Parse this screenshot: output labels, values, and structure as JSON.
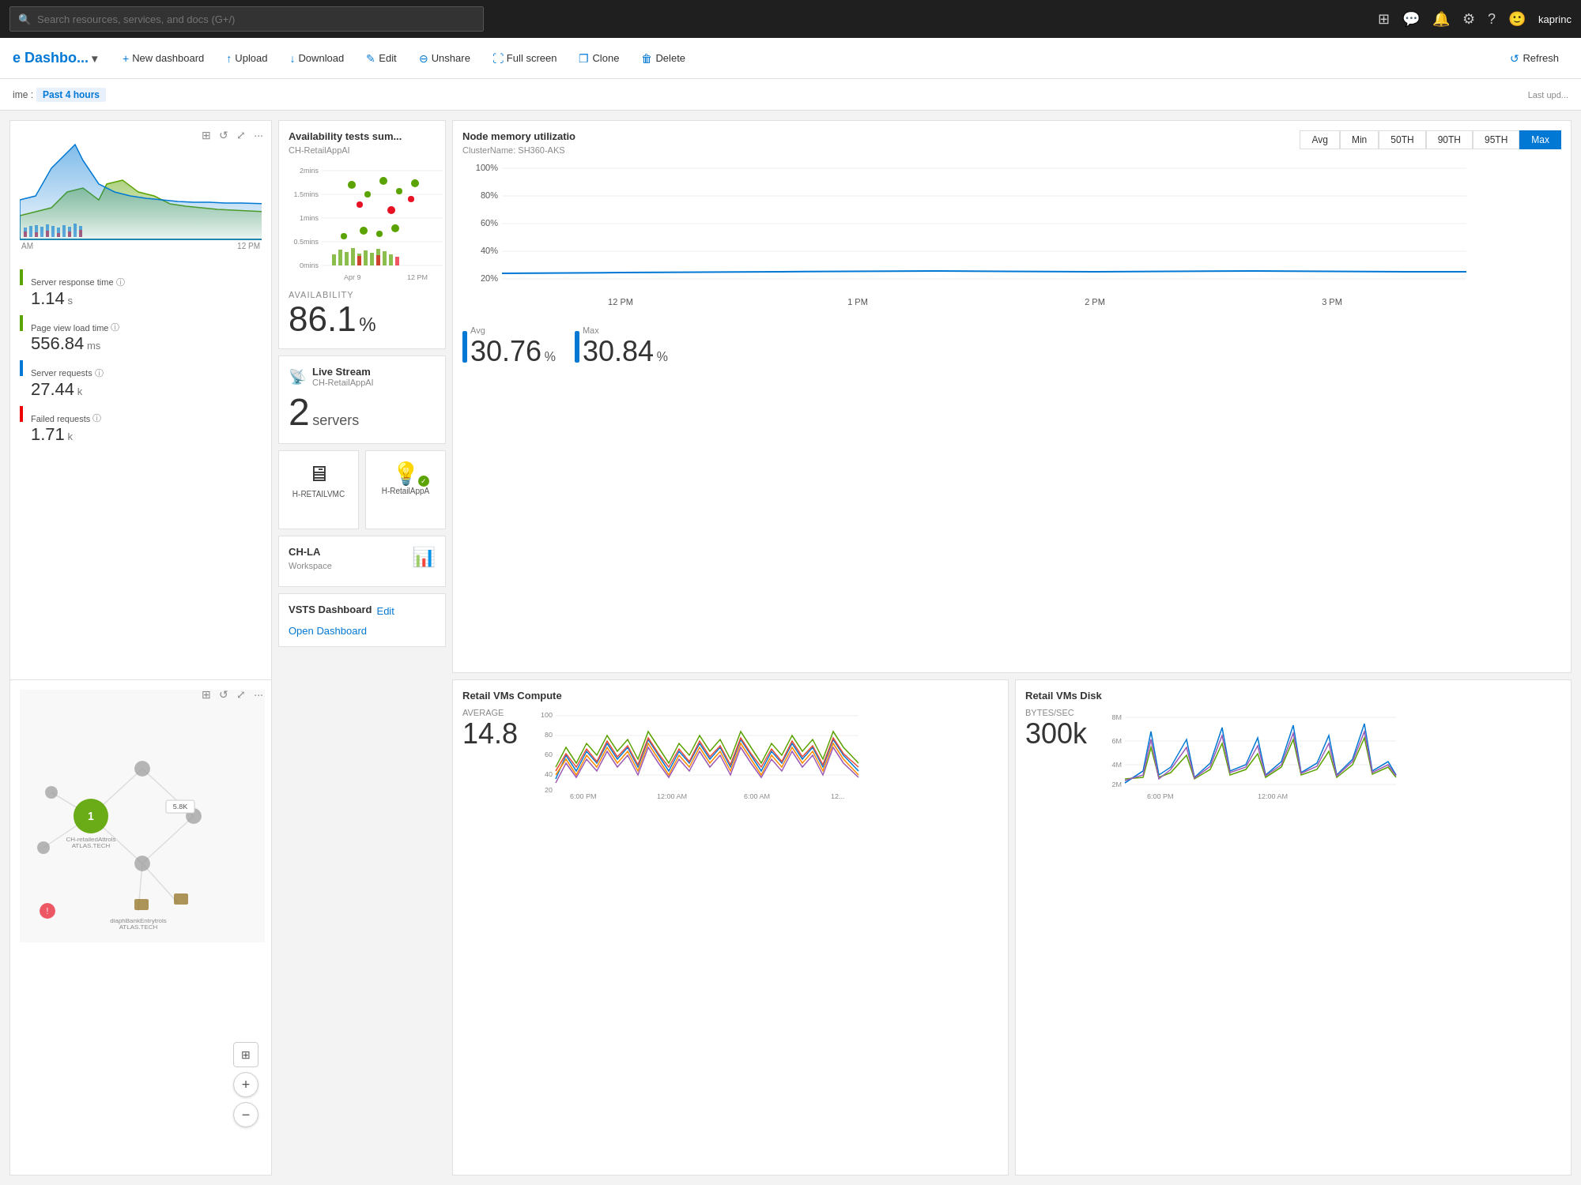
{
  "topNav": {
    "searchPlaceholder": "Search resources, services, and docs (G+/)",
    "userName": "kaprinc",
    "icons": [
      "terminal",
      "feedback",
      "bell",
      "gear",
      "help",
      "face"
    ]
  },
  "toolbar": {
    "title": "e Dashbo...",
    "buttons": [
      {
        "label": "New dashboard",
        "icon": "+",
        "name": "new-dashboard"
      },
      {
        "label": "Upload",
        "icon": "↑",
        "name": "upload"
      },
      {
        "label": "Download",
        "icon": "↓",
        "name": "download"
      },
      {
        "label": "Edit",
        "icon": "✎",
        "name": "edit"
      },
      {
        "label": "Unshare",
        "icon": "⊖",
        "name": "unshare"
      },
      {
        "label": "Full screen",
        "icon": "⛶",
        "name": "full-screen"
      },
      {
        "label": "Clone",
        "icon": "❐",
        "name": "clone"
      },
      {
        "label": "Delete",
        "icon": "🗑",
        "name": "delete"
      },
      {
        "label": "Refresh",
        "icon": "↺",
        "name": "refresh"
      }
    ]
  },
  "timeBar": {
    "label": "ime :",
    "value": "Past 4 hours",
    "lastUpdated": "Last upd..."
  },
  "appInsights": {
    "serverResponseTime": {
      "label": "Server response time",
      "value": "1.14",
      "unit": "s"
    },
    "pageViewLoadTime": {
      "label": "Page view load time",
      "value": "556.84",
      "unit": "ms"
    },
    "serverRequests": {
      "label": "Server requests",
      "value": "27.44",
      "unit": "k"
    },
    "failedRequests": {
      "label": "Failed requests",
      "value": "1.71",
      "unit": "k"
    },
    "timeLabels": [
      "AM",
      "12 PM"
    ]
  },
  "availability": {
    "title": "Availability tests sum...",
    "subtitle": "CH-RetailAppAI",
    "availabilityLabel": "AVAILABILITY",
    "value": "86.1",
    "unit": "%",
    "yLabels": [
      "2mins",
      "1.5mins",
      "1mins",
      "0.5mins",
      "0mins"
    ],
    "xLabels": [
      "Apr 9",
      "12 PM"
    ]
  },
  "liveStream": {
    "title": "Live Stream",
    "subtitle": "CH-RetailAppAI",
    "count": "2",
    "unit": "servers"
  },
  "tiles": [
    {
      "icon": "🖥",
      "label": "H-RETAILVMC"
    },
    {
      "icon": "💡",
      "label": "H-RetailAppA",
      "badge": "✓"
    }
  ],
  "chla": {
    "title": "CH-LA",
    "subtitle": "Workspace"
  },
  "vsts": {
    "title": "VSTS Dashboard",
    "editLabel": "Edit",
    "openLabel": "Open Dashboard"
  },
  "nodeMemory": {
    "title": "Node memory utilizatio",
    "clusterName": "ClusterName: SH360-AKS",
    "tabs": [
      "Avg",
      "Min",
      "50TH",
      "90TH",
      "95TH",
      "Max"
    ],
    "activeTab": "Max",
    "yLabels": [
      "100%",
      "80%",
      "60%",
      "40%",
      "20%"
    ],
    "xLabels": [
      "12 PM",
      "1 PM",
      "2 PM",
      "3 PM"
    ],
    "stats": [
      {
        "label": "Avg",
        "value": "30.76",
        "unit": "%"
      },
      {
        "label": "Max",
        "value": "30.84",
        "unit": "%"
      }
    ]
  },
  "retailCompute": {
    "title": "Retail VMs Compute",
    "averageLabel": "AVERAGE",
    "average": "14.8",
    "yLabels": [
      "100",
      "80",
      "60",
      "40",
      "20"
    ],
    "xLabels": [
      "6:00 PM",
      "12:00 AM",
      "6:00 AM",
      "12..."
    ]
  },
  "retailDisk": {
    "title": "Retail VMs Disk",
    "bytesLabel": "BYTES/SEC",
    "bytes": "300k",
    "yLabels": [
      "8M",
      "6M",
      "4M",
      "2M"
    ],
    "xLabels": [
      "6:00 PM",
      "12:00 AM"
    ]
  }
}
